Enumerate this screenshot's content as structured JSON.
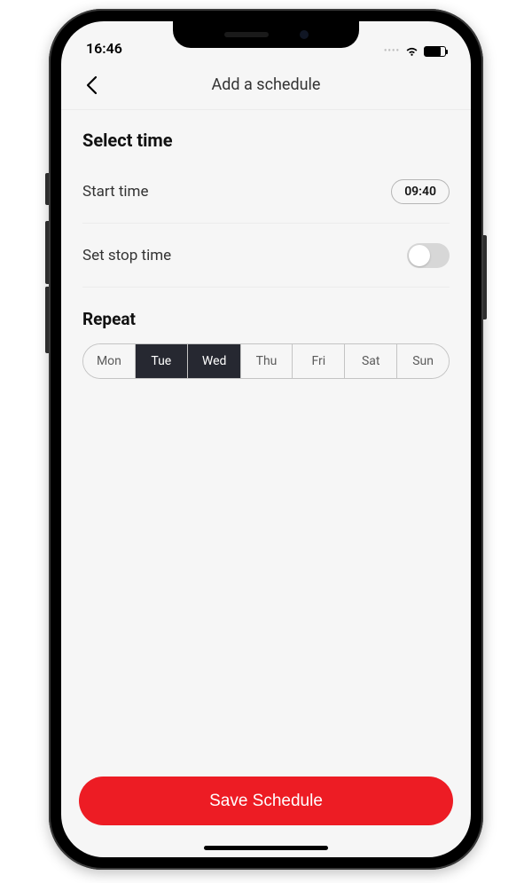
{
  "status": {
    "time": "16:46"
  },
  "nav": {
    "title": "Add a schedule"
  },
  "section": {
    "select_time": "Select time"
  },
  "rows": {
    "start_label": "Start time",
    "start_value": "09:40",
    "stop_label": "Set stop time",
    "stop_enabled": false
  },
  "repeat": {
    "title": "Repeat",
    "days": [
      {
        "label": "Mon",
        "selected": false
      },
      {
        "label": "Tue",
        "selected": true
      },
      {
        "label": "Wed",
        "selected": true
      },
      {
        "label": "Thu",
        "selected": false
      },
      {
        "label": "Fri",
        "selected": false
      },
      {
        "label": "Sat",
        "selected": false
      },
      {
        "label": "Sun",
        "selected": false
      }
    ]
  },
  "save": {
    "label": "Save Schedule"
  },
  "colors": {
    "accent": "#ed1c24",
    "seg_selected": "#262831"
  }
}
